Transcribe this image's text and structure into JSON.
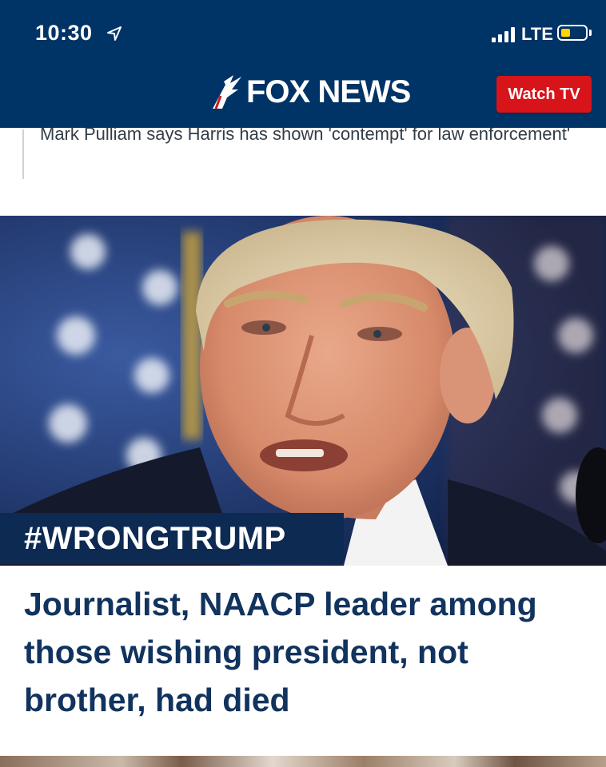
{
  "status_bar": {
    "time": "10:30",
    "network": "LTE",
    "battery_color": "#ffd500"
  },
  "header": {
    "logo_text": "FOX NEWS",
    "watch_tv_label": "Watch TV",
    "background": "#003366",
    "accent": "#d7141a"
  },
  "previous_article": {
    "snippet": "Mark Pulliam says Harris has shown 'contempt' for law enforcement'"
  },
  "hero": {
    "hashtag": "#WRONGTRUMP",
    "headline": "Journalist, NAACP leader among those wishing president, not brother, had died"
  }
}
